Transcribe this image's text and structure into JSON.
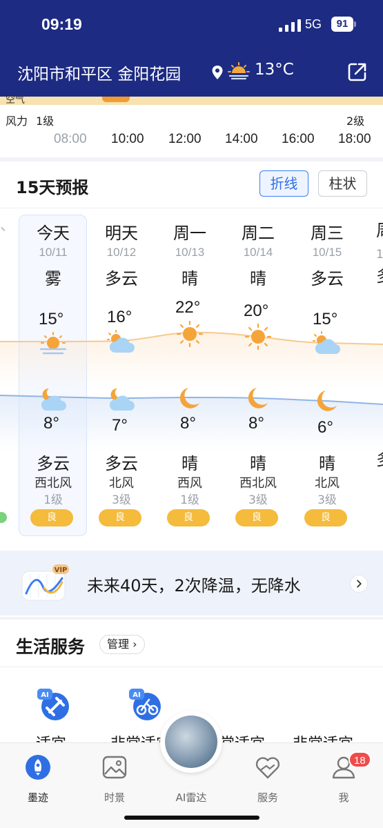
{
  "status_bar": {
    "time": "09:19",
    "network": "5G",
    "battery": "91"
  },
  "header": {
    "location": "沈阳市和平区 金阳花园",
    "current_temp": "13°C"
  },
  "hourly": {
    "aq_label": "空气",
    "wind_label": "风力",
    "wind_levels": [
      "1级",
      "2级"
    ],
    "hours": [
      "08:00",
      "10:00",
      "12:00",
      "14:00",
      "16:00",
      "18:00"
    ]
  },
  "forecast": {
    "title": "15天预报",
    "toggle_line": "折线",
    "toggle_bar": "柱状",
    "days": [
      {
        "name": "今天",
        "date": "10/11",
        "cond_day": "雾",
        "high": "15°",
        "low": "8°",
        "cond_night": "多云",
        "wind_dir": "西北风",
        "wind_level": "1级",
        "aqi": "良"
      },
      {
        "name": "明天",
        "date": "10/12",
        "cond_day": "多云",
        "high": "16°",
        "low": "7°",
        "cond_night": "多云",
        "wind_dir": "北风",
        "wind_level": "3级",
        "aqi": "良"
      },
      {
        "name": "周一",
        "date": "10/13",
        "cond_day": "晴",
        "high": "22°",
        "low": "8°",
        "cond_night": "晴",
        "wind_dir": "西风",
        "wind_level": "1级",
        "aqi": "良"
      },
      {
        "name": "周二",
        "date": "10/14",
        "cond_day": "晴",
        "high": "20°",
        "low": "8°",
        "cond_night": "晴",
        "wind_dir": "西北风",
        "wind_level": "3级",
        "aqi": "良"
      },
      {
        "name": "周三",
        "date": "10/15",
        "cond_day": "多云",
        "high": "15°",
        "low": "6°",
        "cond_night": "晴",
        "wind_dir": "北风",
        "wind_level": "3级",
        "aqi": "良"
      }
    ]
  },
  "vip": {
    "badge": "VIP",
    "text": "未来40天，2次降温，无降水"
  },
  "life": {
    "title": "生活服务",
    "manage": "管理",
    "ai_tag": "AI",
    "items": [
      "适宜",
      "非常适宜",
      "常适宜",
      "非常适宜"
    ]
  },
  "nav": {
    "items": [
      "墨迹",
      "时景",
      "AI雷达",
      "服务",
      "我"
    ],
    "badge": "18"
  },
  "colors": {
    "header_bg": "#1d2b82",
    "accent_blue": "#2f6fe4",
    "aqi_good": "#f4bb3c",
    "high_line": "#f6c98f",
    "low_line": "#8fb4e6"
  }
}
